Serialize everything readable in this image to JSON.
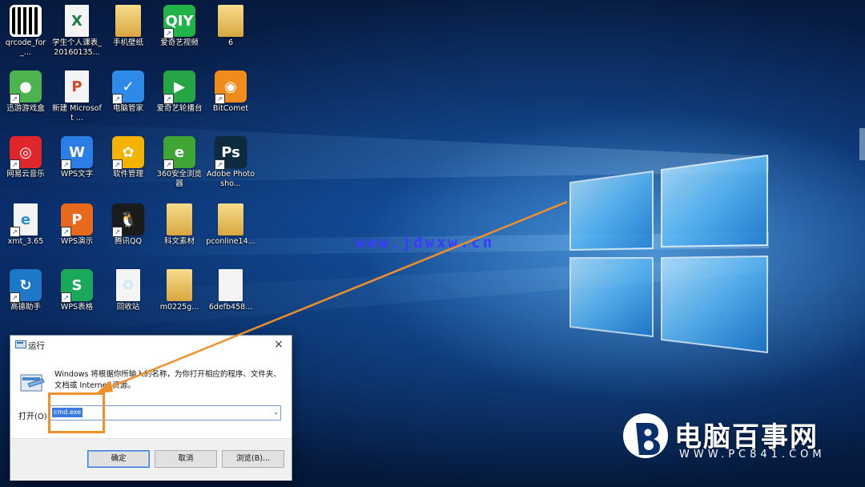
{
  "desktop": {
    "icons": [
      {
        "label": "qrcode_for_...",
        "icon": "qrcode-icon",
        "color": "#ffffff"
      },
      {
        "label": "学生个人课表_20160135...",
        "icon": "excel-file-icon",
        "color": "#1e7e45"
      },
      {
        "label": "手机壁纸",
        "icon": "folder-icon",
        "color": "#e8c164"
      },
      {
        "label": "爱奇艺视频",
        "icon": "iqiyi-icon",
        "color": "#1fb34a"
      },
      {
        "label": "6",
        "icon": "folder-icon",
        "color": "#e8c164"
      },
      {
        "label": "迅游游戏盒",
        "icon": "game-box-icon",
        "color": "#4db34f"
      },
      {
        "label": "新建 Microsoft ...",
        "icon": "powerpoint-file-icon",
        "color": "#d24726"
      },
      {
        "label": "电脑管家",
        "icon": "pc-manager-icon",
        "color": "#2d8ae6"
      },
      {
        "label": "爱奇艺轮播台",
        "icon": "iqiyi-player-icon",
        "color": "#25a546"
      },
      {
        "label": "BitComet",
        "icon": "bitcomet-icon",
        "color": "#f08c1c"
      },
      {
        "label": "网易云音乐",
        "icon": "netease-music-icon",
        "color": "#e0262b"
      },
      {
        "label": "WPS文字",
        "icon": "wps-writer-icon",
        "color": "#2b7de8"
      },
      {
        "label": "软件管理",
        "icon": "software-manager-icon",
        "color": "#f4b300"
      },
      {
        "label": "360安全浏览器",
        "icon": "360-browser-icon",
        "color": "#3fa535"
      },
      {
        "label": "Adobe Photosho...",
        "icon": "photoshop-icon",
        "color": "#0d2a3f"
      },
      {
        "label": "xmt_3.65",
        "icon": "ie-file-icon",
        "color": "#2a8fd8"
      },
      {
        "label": "WPS演示",
        "icon": "wps-presentation-icon",
        "color": "#e8681c"
      },
      {
        "label": "腾讯QQ",
        "icon": "qq-icon",
        "color": "#1b1b1b"
      },
      {
        "label": "科文素材",
        "icon": "document-folder-icon",
        "color": "#e8c164"
      },
      {
        "label": "pconline14...",
        "icon": "archive-folder-icon",
        "color": "#e8c164"
      },
      {
        "label": "高德助手",
        "icon": "map-assistant-icon",
        "color": "#1d78c8"
      },
      {
        "label": "WPS表格",
        "icon": "wps-spreadsheet-icon",
        "color": "#1aa95a"
      },
      {
        "label": "回收站",
        "icon": "recycle-bin-icon",
        "color": "#cfe3f2"
      },
      {
        "label": "m0225g...",
        "icon": "document-folder-icon",
        "color": "#e8c164"
      },
      {
        "label": "6defb458...",
        "icon": "image-file-icon",
        "color": "#b07b50"
      }
    ],
    "glyphs": [
      "",
      "X",
      "",
      "QIY",
      "",
      "●",
      "P",
      "✓",
      "▶",
      "◉",
      "◎",
      "W",
      "✿",
      "e",
      "Ps",
      "e",
      "P",
      "🐧",
      "",
      "",
      "↻",
      "S",
      "♻",
      "",
      ""
    ]
  },
  "watermark": "www.jdwxw.cn",
  "brand": {
    "name": "电脑百事网",
    "url": "WWW.PC841.COM"
  },
  "run_dialog": {
    "title": "运行",
    "close_glyph": "×",
    "description": "Windows 将根据你所输入的名称，为你打开相应的程序、文件夹、文档或 Internet 资源。",
    "open_label": "打开(O):",
    "input_value": "cmd.exe",
    "dropdown_glyph": "⌄",
    "buttons": {
      "ok": "确定",
      "cancel": "取消",
      "browse": "浏览(B)..."
    }
  },
  "annotation": {
    "arrow_color": "#f0902a",
    "highlight_color": "#f0902a"
  }
}
